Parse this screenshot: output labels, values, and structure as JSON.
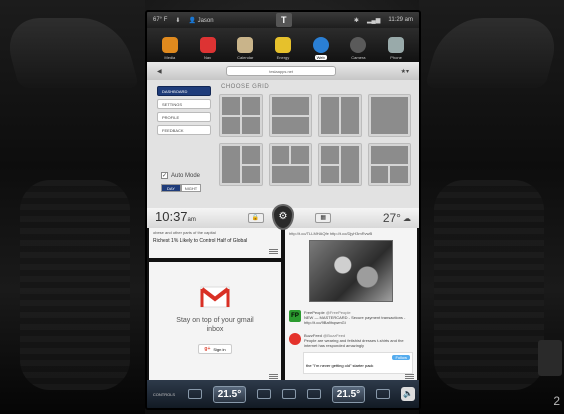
{
  "statusbar": {
    "temperature": "67° F",
    "user": "Jason",
    "time": "11:29 am"
  },
  "apps": [
    {
      "label": "Media",
      "color": "#e08a1e"
    },
    {
      "label": "Nav",
      "color": "#d33"
    },
    {
      "label": "Calendar",
      "color": "#c9b48a"
    },
    {
      "label": "Energy",
      "color": "#e6c12c"
    },
    {
      "label": "Web",
      "color": "#2a7fd4",
      "active": true
    },
    {
      "label": "Camera",
      "color": "#5a5a5a"
    },
    {
      "label": "Phone",
      "color": "#9aa"
    }
  ],
  "web": {
    "url": "teslaapps.net"
  },
  "dashboard": {
    "menu": [
      "DASHBOARD",
      "SETTINGS",
      "PROFILE",
      "FEEDBACK"
    ],
    "grid_title": "CHOOSE GRID",
    "auto_mode": "Auto Mode",
    "day": "DAY",
    "night": "NIGHT"
  },
  "clock": {
    "time": "10:37",
    "ampm": "am",
    "outside_temp": "27°"
  },
  "news": {
    "snippet": "obese and other parts of the capital",
    "headline": "Richest 1% Likely to Control Half of Global"
  },
  "gmail": {
    "text": "Stay on top of your gmail inbox",
    "signin": "Sign in"
  },
  "twitter": {
    "link": "http://t.co/TLLMHAQfe http://t.co/DjyH3mRvwB",
    "tweets": [
      {
        "name": "FreePeople",
        "handle": "@FreePeople",
        "text": "NEW — MASTERCARD - Secure payment transactions - http://t.co/9Ba9hqwmGi"
      },
      {
        "name": "BuzzFeed",
        "handle": "@BuzzFeed",
        "text": "People are wearing and fetishist dresses t-shirts and the internet has responded amazingly"
      }
    ],
    "embed_text": "the \"I'm never getting old\" starter pack",
    "follow": "Follow"
  },
  "climate": {
    "left_temp": "21.5°",
    "right_temp": "21.5°",
    "controls": "CONTROLS"
  },
  "edge": {
    "number": "2"
  }
}
